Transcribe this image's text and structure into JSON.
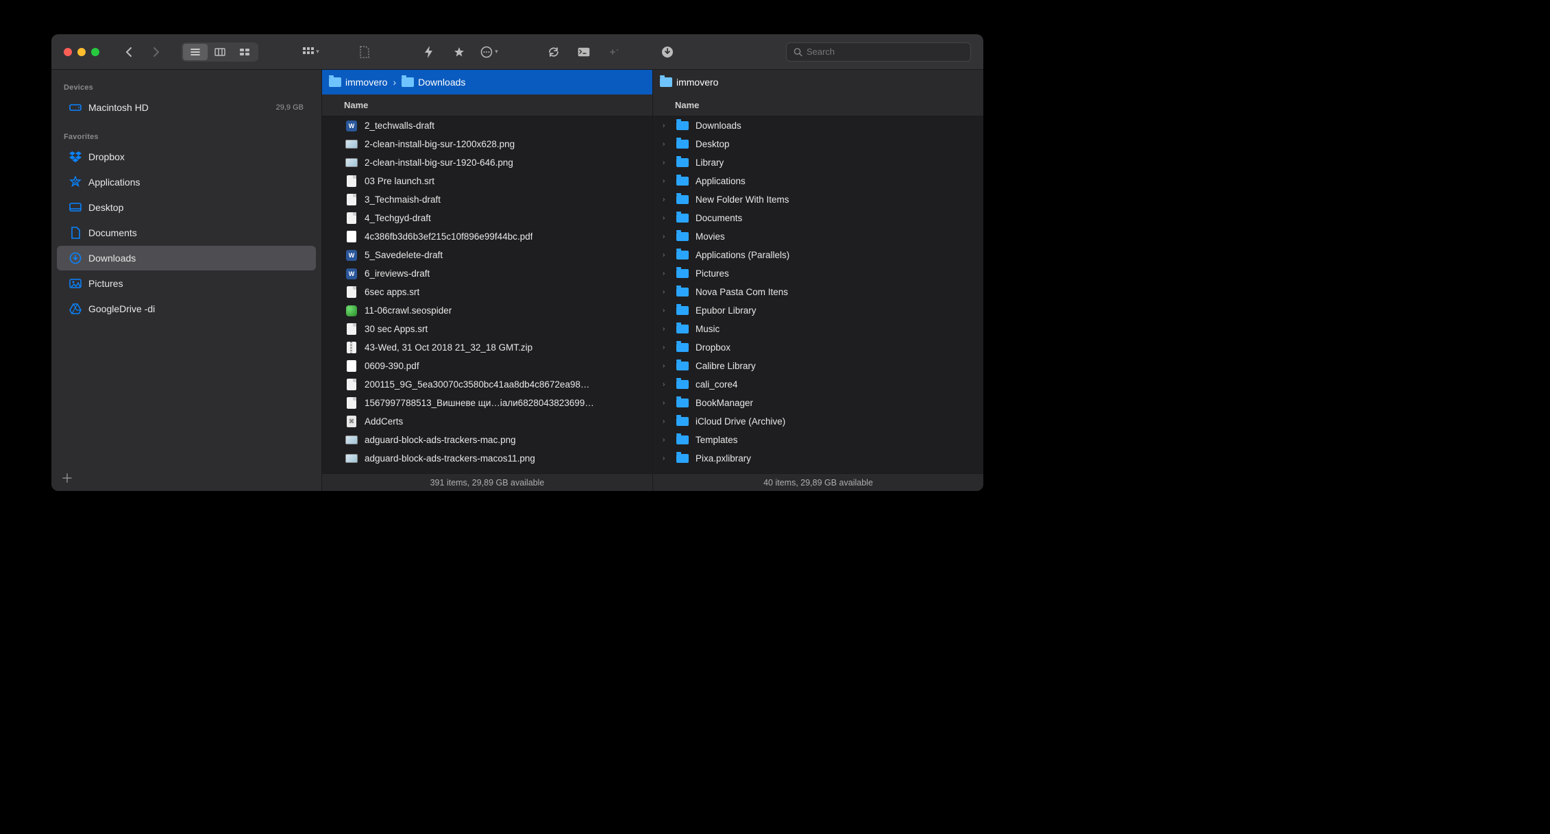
{
  "toolbar": {
    "search_placeholder": "Search"
  },
  "sidebar": {
    "sections": [
      {
        "title": "Devices",
        "items": [
          {
            "icon": "hdd",
            "label": "Macintosh HD",
            "badge": "29,9 GB"
          }
        ]
      },
      {
        "title": "Favorites",
        "items": [
          {
            "icon": "dropbox",
            "label": "Dropbox"
          },
          {
            "icon": "applications",
            "label": "Applications"
          },
          {
            "icon": "desktop",
            "label": "Desktop"
          },
          {
            "icon": "documents",
            "label": "Documents"
          },
          {
            "icon": "downloads",
            "label": "Downloads",
            "selected": true
          },
          {
            "icon": "pictures",
            "label": "Pictures"
          },
          {
            "icon": "gdrive",
            "label": "GoogleDrive -di"
          }
        ]
      }
    ]
  },
  "panes": [
    {
      "active": true,
      "path": [
        "immovero",
        "Downloads"
      ],
      "column_header": "Name",
      "status": "391 items, 29,89 GB available",
      "items": [
        {
          "type": "word",
          "name": "2_techwalls-draft"
        },
        {
          "type": "img",
          "name": "2-clean-install-big-sur-1200x628.png"
        },
        {
          "type": "img",
          "name": "2-clean-install-big-sur-1920-646.png"
        },
        {
          "type": "doc",
          "name": "03 Pre launch.srt"
        },
        {
          "type": "doc",
          "name": "3_Techmaish-draft"
        },
        {
          "type": "doc",
          "name": "4_Techgyd-draft"
        },
        {
          "type": "pdf",
          "name": "4c386fb3d6b3ef215c10f896e99f44bc.pdf"
        },
        {
          "type": "word",
          "name": "5_Savedelete-draft"
        },
        {
          "type": "word",
          "name": "6_ireviews-draft"
        },
        {
          "type": "doc",
          "name": "6sec apps.srt"
        },
        {
          "type": "app",
          "name": "11-06crawl.seospider"
        },
        {
          "type": "doc",
          "name": "30 sec Apps.srt"
        },
        {
          "type": "zip",
          "name": "43-Wed, 31 Oct 2018 21_32_18 GMT.zip"
        },
        {
          "type": "pdf",
          "name": "0609-390.pdf"
        },
        {
          "type": "doc",
          "name": "200115_9G_5ea30070c3580bc41aa8db4c8672ea98…"
        },
        {
          "type": "doc",
          "name": "1567997788513_Вишневе щи…іали6828043823699…"
        },
        {
          "type": "sh",
          "name": "AddCerts"
        },
        {
          "type": "img",
          "name": "adguard-block-ads-trackers-mac.png"
        },
        {
          "type": "img",
          "name": "adguard-block-ads-trackers-macos11.png"
        }
      ]
    },
    {
      "active": false,
      "path": [
        "immovero"
      ],
      "column_header": "Name",
      "status": "40 items, 29,89 GB available",
      "items": [
        {
          "type": "folder",
          "name": "Downloads"
        },
        {
          "type": "folder",
          "name": "Desktop"
        },
        {
          "type": "folder",
          "name": "Library"
        },
        {
          "type": "folder",
          "name": "Applications"
        },
        {
          "type": "folder",
          "name": "New Folder With Items"
        },
        {
          "type": "folder",
          "name": "Documents"
        },
        {
          "type": "folder",
          "name": "Movies"
        },
        {
          "type": "folder",
          "name": "Applications (Parallels)"
        },
        {
          "type": "folder",
          "name": "Pictures"
        },
        {
          "type": "folder",
          "name": "Nova Pasta Com Itens"
        },
        {
          "type": "folder",
          "name": "Epubor Library"
        },
        {
          "type": "folder",
          "name": "Music"
        },
        {
          "type": "folder",
          "name": "Dropbox"
        },
        {
          "type": "folder",
          "name": "Calibre Library"
        },
        {
          "type": "folder",
          "name": "cali_core4"
        },
        {
          "type": "folder",
          "name": "BookManager"
        },
        {
          "type": "folder",
          "name": "iCloud Drive (Archive)"
        },
        {
          "type": "folder",
          "name": "Templates"
        },
        {
          "type": "folder",
          "name": "Pixa.pxlibrary"
        }
      ]
    }
  ]
}
